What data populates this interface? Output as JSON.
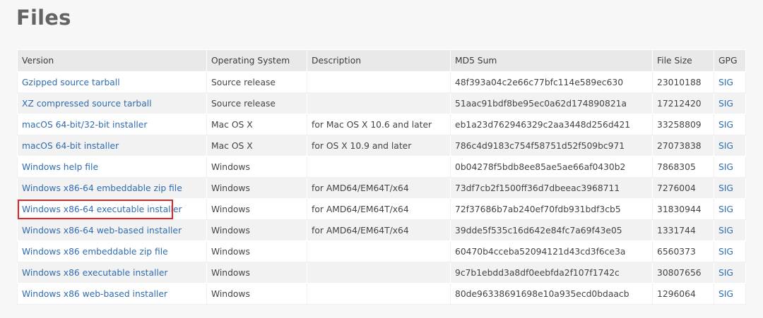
{
  "page": {
    "title": "Files"
  },
  "table": {
    "headers": [
      "Version",
      "Operating System",
      "Description",
      "MD5 Sum",
      "File Size",
      "GPG"
    ],
    "rows": [
      {
        "version": "Gzipped source tarball",
        "os": "Source release",
        "description": "",
        "md5": "48f393a04c2e66c77bfc114e589ec630",
        "size": "23010188",
        "gpg": "SIG",
        "highlighted": false
      },
      {
        "version": "XZ compressed source tarball",
        "os": "Source release",
        "description": "",
        "md5": "51aac91bdf8be95ec0a62d174890821a",
        "size": "17212420",
        "gpg": "SIG",
        "highlighted": false
      },
      {
        "version": "macOS 64-bit/32-bit installer",
        "os": "Mac OS X",
        "description": "for Mac OS X 10.6 and later",
        "md5": "eb1a23d762946329c2aa3448d256d421",
        "size": "33258809",
        "gpg": "SIG",
        "highlighted": false
      },
      {
        "version": "macOS 64-bit installer",
        "os": "Mac OS X",
        "description": "for OS X 10.9 and later",
        "md5": "786c4d9183c754f58751d52f509bc971",
        "size": "27073838",
        "gpg": "SIG",
        "highlighted": false
      },
      {
        "version": "Windows help file",
        "os": "Windows",
        "description": "",
        "md5": "0b04278f5bdb8ee85ae5ae66af0430b2",
        "size": "7868305",
        "gpg": "SIG",
        "highlighted": false
      },
      {
        "version": "Windows x86-64 embeddable zip file",
        "os": "Windows",
        "description": "for AMD64/EM64T/x64",
        "md5": "73df7cb2f1500ff36d7dbeeac3968711",
        "size": "7276004",
        "gpg": "SIG",
        "highlighted": false
      },
      {
        "version": "Windows x86-64 executable installer",
        "os": "Windows",
        "description": "for AMD64/EM64T/x64",
        "md5": "72f37686b7ab240ef70fdb931bdf3cb5",
        "size": "31830944",
        "gpg": "SIG",
        "highlighted": true
      },
      {
        "version": "Windows x86-64 web-based installer",
        "os": "Windows",
        "description": "for AMD64/EM64T/x64",
        "md5": "39dde5f535c16d642e84fc7a69f43e05",
        "size": "1331744",
        "gpg": "SIG",
        "highlighted": false
      },
      {
        "version": "Windows x86 embeddable zip file",
        "os": "Windows",
        "description": "",
        "md5": "60470b4cceba52094121d43cd3f6ce3a",
        "size": "6560373",
        "gpg": "SIG",
        "highlighted": false
      },
      {
        "version": "Windows x86 executable installer",
        "os": "Windows",
        "description": "",
        "md5": "9c7b1ebdd3a8df0eebfda2f107f1742c",
        "size": "30807656",
        "gpg": "SIG",
        "highlighted": false
      },
      {
        "version": "Windows x86 web-based installer",
        "os": "Windows",
        "description": "",
        "md5": "80de96338691698e10a935ecd0bdaacb",
        "size": "1296064",
        "gpg": "SIG",
        "highlighted": false
      }
    ]
  },
  "colors": {
    "link": "#2f6db0",
    "highlight_border": "#e02424",
    "header_bg": "#e9e9e9",
    "stripe_bg": "#f2f2f2"
  }
}
